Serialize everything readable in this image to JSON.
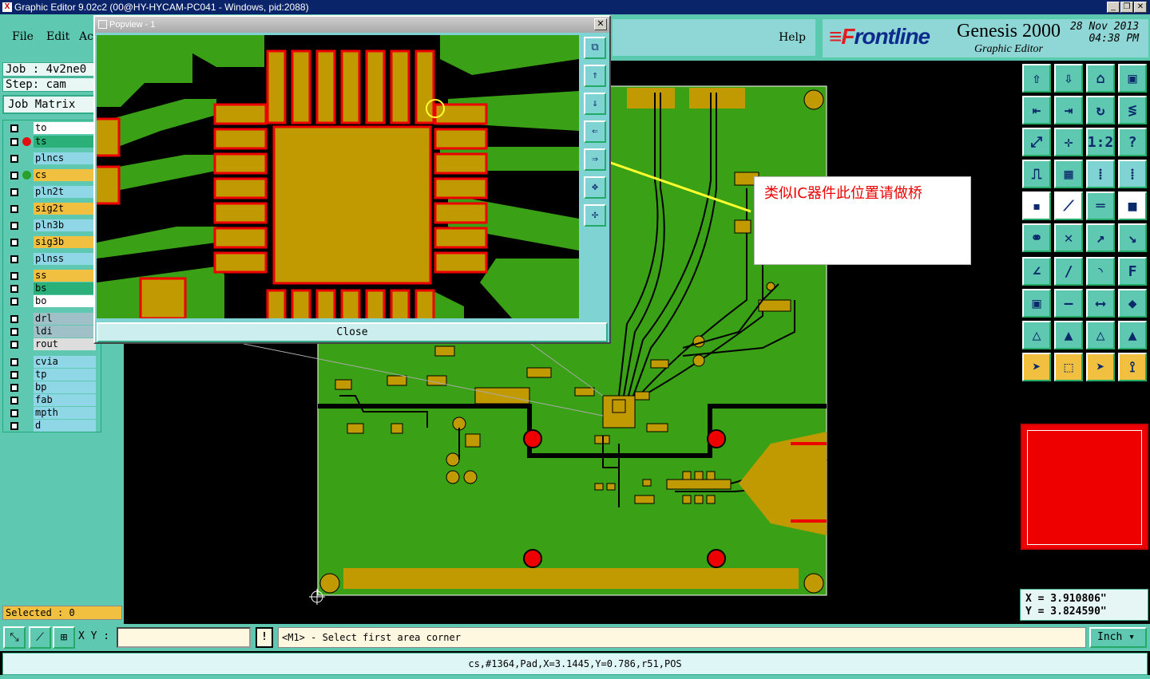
{
  "window": {
    "title": "Graphic Editor 9.02c2 (00@HY-HYCAM-PC041 - Windows, pid:2088)",
    "min": "_",
    "max": "❐",
    "close": "✕"
  },
  "menu": {
    "file": "File",
    "edit": "Edit",
    "action": "Ac",
    "help": "Help"
  },
  "brand": {
    "logo_prefix": "F",
    "logo_rest": "rontline",
    "product": "Genesis 2000",
    "subtitle": "Graphic Editor",
    "date": "28 Nov 2013",
    "time": "04:38 PM"
  },
  "job": {
    "job": "Job : 4v2ne0",
    "step": "Step: cam",
    "matrix": "Job Matrix"
  },
  "layers": [
    {
      "name": "to",
      "bg": "#ffffff",
      "dot": ""
    },
    {
      "name": "ts",
      "bg": "#2bb07a",
      "dot": "#e01010"
    },
    {
      "name": "plncs",
      "bg": "#8fd6e6",
      "dot": ""
    },
    {
      "name": "cs",
      "bg": "#f2c040",
      "dot": "#2aa02a"
    },
    {
      "name": "pln2t",
      "bg": "#8fd6e6",
      "dot": ""
    },
    {
      "name": "sig2t",
      "bg": "#f2c040",
      "dot": ""
    },
    {
      "name": "pln3b",
      "bg": "#8fd6e6",
      "dot": ""
    },
    {
      "name": "sig3b",
      "bg": "#f2c040",
      "dot": ""
    },
    {
      "name": "plnss",
      "bg": "#8fd6e6",
      "dot": ""
    },
    {
      "name": "ss",
      "bg": "#f2c040",
      "dot": ""
    },
    {
      "name": "bs",
      "bg": "#2bb07a",
      "dot": ""
    },
    {
      "name": "bo",
      "bg": "#ffffff",
      "dot": ""
    },
    {
      "name": "drl",
      "bg": "#a0c0c8",
      "dot": ""
    },
    {
      "name": "ldi",
      "bg": "#a0c0c8",
      "dot": ""
    },
    {
      "name": "rout",
      "bg": "#dddddd",
      "dot": ""
    },
    {
      "name": "cvia",
      "bg": "#8fd6e6",
      "dot": ""
    },
    {
      "name": "tp",
      "bg": "#8fd6e6",
      "dot": ""
    },
    {
      "name": "bp",
      "bg": "#8fd6e6",
      "dot": ""
    },
    {
      "name": "fab",
      "bg": "#8fd6e6",
      "dot": ""
    },
    {
      "name": "mpth",
      "bg": "#8fd6e6",
      "dot": ""
    },
    {
      "name": "d",
      "bg": "#8fd6e6",
      "dot": ""
    }
  ],
  "selected": "Selected : 0",
  "command": {
    "xy_label": "X Y :",
    "xy_value": "",
    "excl": "!",
    "prompt": "<M1> - Select first area corner",
    "units": "Inch ▾"
  },
  "status": "cs,#1364,Pad,X=3.1445,Y=0.786,r51,POS",
  "coords": {
    "x": "X = 3.910806\"",
    "y": "Y = 3.824590\""
  },
  "popview": {
    "title": "Popview - 1",
    "close_x": "✕",
    "close_button": "Close"
  },
  "annotation": {
    "text": "类似IC器件此位置请做桥"
  },
  "colors": {
    "board_green": "#3aa015",
    "pad_gold": "#c09a00",
    "pad_outline": "#e00000",
    "highlight": "#ffff30",
    "panel": "#5ec8b0"
  }
}
